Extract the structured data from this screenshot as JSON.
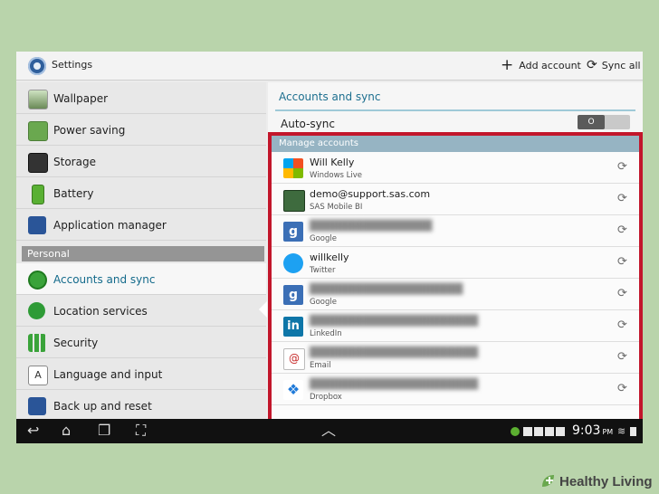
{
  "header": {
    "title": "Settings",
    "add_account_label": "Add account",
    "sync_all_label": "Sync all",
    "icons": {
      "settings": "gear-icon",
      "add": "plus-icon",
      "sync_all": "sync-icon"
    }
  },
  "sidebar": {
    "items": [
      {
        "label": "Wallpaper",
        "icon": "wallpaper-icon",
        "color": "#6a8a57"
      },
      {
        "label": "Power saving",
        "icon": "power-saving-icon",
        "color": "#6aa84f"
      },
      {
        "label": "Storage",
        "icon": "storage-icon",
        "color": "#333333"
      },
      {
        "label": "Battery",
        "icon": "battery-icon",
        "color": "#59b033"
      },
      {
        "label": "Application manager",
        "icon": "app-manager-icon",
        "color": "#2a5598"
      }
    ],
    "section_header": "Personal",
    "personal_items": [
      {
        "label": "Accounts and sync",
        "icon": "accounts-sync-icon",
        "color": "#3aa33a",
        "active": true
      },
      {
        "label": "Location services",
        "icon": "location-icon",
        "color": "#2e9b36"
      },
      {
        "label": "Security",
        "icon": "security-icon",
        "color": "#3aa33a"
      },
      {
        "label": "Language and input",
        "icon": "language-icon",
        "color": "#ffffff"
      },
      {
        "label": "Back up and reset",
        "icon": "backup-icon",
        "color": "#2a5598"
      }
    ]
  },
  "content": {
    "title": "Accounts and sync",
    "auto_sync_label": "Auto-sync",
    "toggle_state": "O"
  },
  "manage": {
    "header": "Manage accounts",
    "accounts": [
      {
        "name": "Will Kelly",
        "type": "Windows Live",
        "icon": "windows-icon",
        "blurred": false
      },
      {
        "name": "demo@support.sas.com",
        "type": "SAS Mobile BI",
        "icon": "sas-icon",
        "blurred": false
      },
      {
        "name": "",
        "type": "Google",
        "icon": "google-icon",
        "blurred": true
      },
      {
        "name": "willkelly",
        "type": "Twitter",
        "icon": "twitter-icon",
        "blurred": false
      },
      {
        "name": "",
        "type": "Google",
        "icon": "google-icon",
        "blurred": true
      },
      {
        "name": "",
        "type": "LinkedIn",
        "icon": "linkedin-icon",
        "blurred": true
      },
      {
        "name": "",
        "type": "Email",
        "icon": "email-icon",
        "blurred": true
      },
      {
        "name": "",
        "type": "Dropbox",
        "icon": "dropbox-icon",
        "blurred": true
      }
    ]
  },
  "statusbar": {
    "time": "9:03",
    "time_suffix": "PM"
  },
  "watermark": {
    "text": "Healthy Living"
  },
  "colors": {
    "accent": "#1d6f8f",
    "highlight_border": "#c2162b",
    "section_header": "#959595"
  }
}
